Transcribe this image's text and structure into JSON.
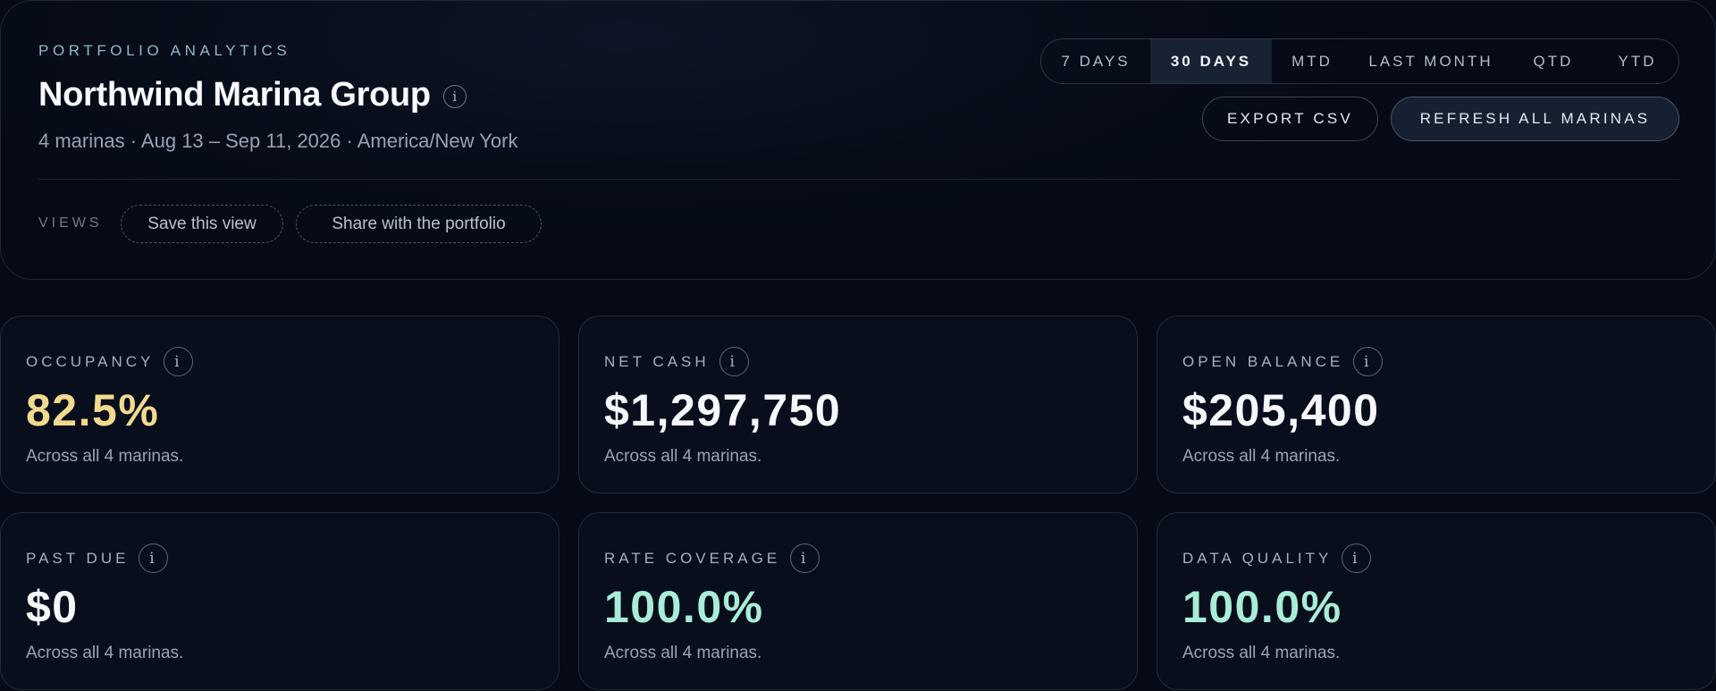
{
  "header": {
    "eyebrow": "PORTFOLIO ANALYTICS",
    "title": "Northwind Marina Group",
    "subtitle": "4 marinas · Aug 13 – Sep 11, 2026 · America/New York",
    "info_glyph": "i"
  },
  "periods": {
    "selected": "30 DAYS",
    "items": [
      {
        "label": "7 DAYS"
      },
      {
        "label": "30 DAYS"
      },
      {
        "label": "MTD"
      },
      {
        "label": "LAST MONTH"
      },
      {
        "label": "QTD"
      },
      {
        "label": "YTD"
      }
    ]
  },
  "actions": {
    "export_label": "EXPORT CSV",
    "refresh_label": "REFRESH ALL MARINAS"
  },
  "views": {
    "label": "VIEWS",
    "save_label": "Save this view",
    "share_label": "Share with the portfolio"
  },
  "colors": {
    "occupancy_value": "#f2d98e",
    "coverage_value": "#a9ecd7",
    "background": "#050a16"
  },
  "metrics": [
    {
      "label": "OCCUPANCY",
      "value": "82.5%",
      "note": "Across all 4 marinas.",
      "icon": "info-icon"
    },
    {
      "label": "NET CASH",
      "value": "$1,297,750",
      "note": "Across all 4 marinas.",
      "icon": "info-icon"
    },
    {
      "label": "OPEN BALANCE",
      "value": "$205,400",
      "note": "Across all 4 marinas.",
      "icon": "info-icon"
    },
    {
      "label": "PAST DUE",
      "value": "$0",
      "note": "Across all 4 marinas.",
      "icon": "info-icon"
    },
    {
      "label": "RATE COVERAGE",
      "value": "100.0%",
      "note": "Across all 4 marinas.",
      "icon": "info-icon"
    },
    {
      "label": "DATA QUALITY",
      "value": "100.0%",
      "note": "Across all 4 marinas.",
      "icon": "info-icon"
    }
  ]
}
